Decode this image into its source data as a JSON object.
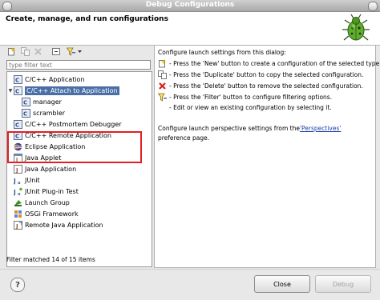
{
  "window": {
    "title": "Debug Configurations"
  },
  "header": {
    "title": "Create, manage, and run configurations"
  },
  "filter": {
    "placeholder": "type filter text"
  },
  "tree": [
    {
      "label": "C/C++ Application",
      "icon": "c-app-icon"
    },
    {
      "label": "C/C++ Attach to Application",
      "icon": "c-attach-icon",
      "expanded": true,
      "selected": true
    },
    {
      "label": "manager",
      "icon": "config-icon",
      "child": true
    },
    {
      "label": "scrambler",
      "icon": "config-icon",
      "child": true
    },
    {
      "label": "C/C++ Postmortem Debugger",
      "icon": "c-postmortem-icon"
    },
    {
      "label": "C/C++ Remote Application",
      "icon": "c-remote-icon"
    },
    {
      "label": "Eclipse Application",
      "icon": "eclipse-icon"
    },
    {
      "label": "Java Applet",
      "icon": "java-applet-icon"
    },
    {
      "label": "Java Application",
      "icon": "java-app-icon"
    },
    {
      "label": "JUnit",
      "icon": "junit-icon"
    },
    {
      "label": "JUnit Plug-in Test",
      "icon": "junit-plugin-icon"
    },
    {
      "label": "Launch Group",
      "icon": "launch-group-icon"
    },
    {
      "label": "OSGi Framework",
      "icon": "osgi-icon"
    },
    {
      "label": "Remote Java Application",
      "icon": "remote-java-icon"
    }
  ],
  "status": "Filter matched 14 of 15 items",
  "info": {
    "intro": "Configure launch settings from this dialog:",
    "new": "- Press the 'New' button to create a configuration of the selected type.",
    "duplicate": "- Press the 'Duplicate' button to copy the selected configuration.",
    "delete": "- Press the 'Delete' button to remove the selected configuration.",
    "filter": "- Press the 'Filter' button to configure filtering options.",
    "edit": "- Edit or view an existing configuration by selecting it.",
    "perspective_prefix": "Configure launch perspective settings from the ",
    "perspective_link": "'Perspectives'",
    "perspective_suffix": "preference page."
  },
  "buttons": {
    "close": "Close",
    "debug": "Debug"
  },
  "colors": {
    "selection": "#4a6fa6",
    "highlight": "#e21f24",
    "link": "#1b3fa6"
  }
}
